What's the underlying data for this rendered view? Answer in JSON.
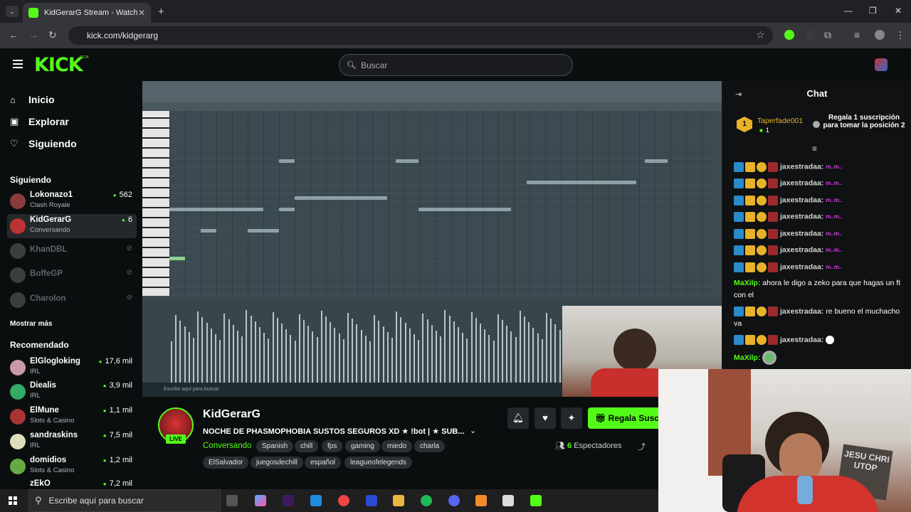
{
  "browser": {
    "tab_title": "KidGerarG Stream - Watch Live",
    "url": "kick.com/kidgerarg",
    "ext_badge": "3"
  },
  "kick": {
    "logo": "KICK",
    "beta": "BETA",
    "search_placeholder": "Buscar"
  },
  "sidebar": {
    "nav": [
      {
        "label": "Inicio",
        "icon": "home-icon"
      },
      {
        "label": "Explorar",
        "icon": "browse-icon"
      },
      {
        "label": "Siguiendo",
        "icon": "heart-icon"
      }
    ],
    "following_title": "Siguiendo",
    "following": [
      {
        "name": "Lokonazo1",
        "sub": "Clash Royale",
        "count": "562",
        "live": true
      },
      {
        "name": "KidGerarG",
        "sub": "Conversando",
        "count": "6",
        "live": true
      },
      {
        "name": "KhanDBL",
        "sub": "",
        "count": "",
        "live": false
      },
      {
        "name": "BoffeGP",
        "sub": "",
        "count": "",
        "live": false
      },
      {
        "name": "Charolon",
        "sub": "",
        "count": "",
        "live": false
      }
    ],
    "show_more": "Mostrar más",
    "recommended_title": "Recomendado",
    "recommended": [
      {
        "name": "ElGlogloking",
        "sub": "IRL",
        "count": "17,6 mil"
      },
      {
        "name": "Diealis",
        "sub": "IRL",
        "count": "3,9 mil"
      },
      {
        "name": "ElMune",
        "sub": "Slots & Casino",
        "count": "1,1 mil"
      },
      {
        "name": "sandraskins",
        "sub": "IRL",
        "count": "7,5 mil"
      },
      {
        "name": "domidios",
        "sub": "Slots & Casino",
        "count": "1,2 mil"
      },
      {
        "name": "zEkO",
        "sub": "",
        "count": "7,2 mil"
      }
    ]
  },
  "stream": {
    "channel": "KidGerarG",
    "live": "LIVE",
    "title": "NOCHE DE PHASMOPHOBIA SUSTOS SEGUROS XD ★ !bot | ★ SUB...",
    "category": "Conversando",
    "tags": [
      "Spanish",
      "chill",
      "fps",
      "gaming",
      "miedo",
      "charla",
      "ElSalvador",
      "juegosdechill",
      "español",
      "leagueofelegends"
    ],
    "gift_label": "Regala Suscripciones",
    "viewers_count": "6",
    "viewers_label": "Espectadores"
  },
  "chat": {
    "title": "Chat",
    "top_rank": "1",
    "top_user": "Taperfade001",
    "top_count": "1",
    "promo": "Regala 1 suscripción para tomar la posición 2",
    "messages": [
      {
        "user": "jaxestradaa:",
        "text": "",
        "emote": "m..m..",
        "badges": true,
        "color": "normal"
      },
      {
        "user": "jaxestradaa:",
        "text": "",
        "emote": "m..m..",
        "badges": true,
        "color": "normal"
      },
      {
        "user": "jaxestradaa:",
        "text": "",
        "emote": "m..m..",
        "badges": true,
        "color": "normal"
      },
      {
        "user": "jaxestradaa:",
        "text": "",
        "emote": "m..m..",
        "badges": true,
        "color": "normal"
      },
      {
        "user": "jaxestradaa:",
        "text": "",
        "emote": "m..m..",
        "badges": true,
        "color": "normal"
      },
      {
        "user": "jaxestradaa:",
        "text": "",
        "emote": "m..m..",
        "badges": true,
        "color": "normal"
      },
      {
        "user": "jaxestradaa:",
        "text": "",
        "emote": "m..m..",
        "badges": true,
        "color": "normal"
      },
      {
        "user": "MaXilp:",
        "text": "ahora le digo a zeko para que hagas un ft con el",
        "emote": "",
        "badges": false,
        "color": "green"
      },
      {
        "user": "jaxestradaa:",
        "text": "re bueno el muchacho va",
        "emote": "",
        "badges": true,
        "color": "normal"
      },
      {
        "user": "jaxestradaa:",
        "text": "",
        "emote": "duck",
        "badges": true,
        "color": "normal"
      },
      {
        "user": "MaXilp:",
        "text": "",
        "emote": "emoji",
        "badges": false,
        "color": "green"
      }
    ]
  },
  "webcam_sign": "JESU CHRI UTOP",
  "fl_taskbar_text": "Escribe aquí para buscar",
  "taskbar": {
    "search_placeholder": "Escribe aquí para buscar"
  }
}
